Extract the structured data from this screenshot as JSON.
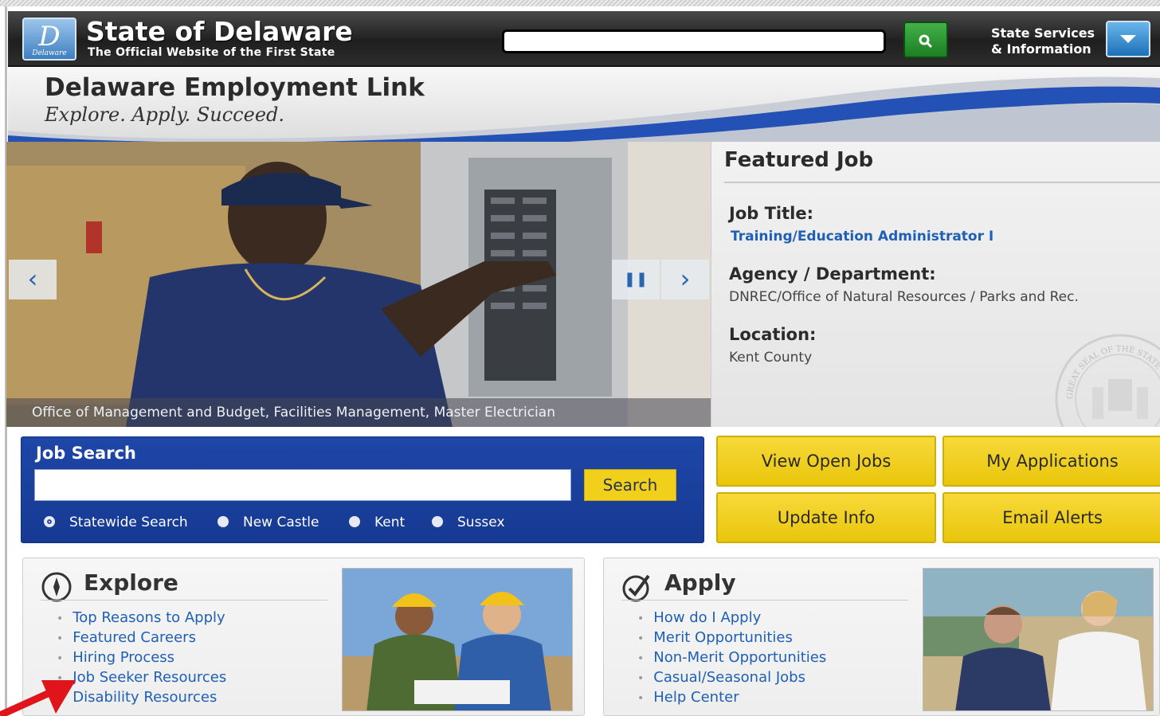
{
  "header": {
    "logo_letter": "D",
    "logo_text": "Delaware",
    "site_title": "State of Delaware",
    "site_subtitle": "The Official Website of the First State",
    "search_placeholder": "",
    "search_icon": "magnifier-icon",
    "state_services_line1": "State Services",
    "state_services_line2": "& Information",
    "dropdown_icon": "chevron-down-icon"
  },
  "banner": {
    "title": "Delaware Employment Link",
    "tagline": "Explore. Apply. Succeed."
  },
  "hero": {
    "caption": "Office of Management and Budget, Facilities Management, Master Electrician",
    "prev_symbol": "‹",
    "pause_symbol": "❚❚",
    "next_symbol": "›"
  },
  "featured": {
    "heading": "Featured Job",
    "job_title_label": "Job Title:",
    "job_title": "Training/Education Administrator I",
    "agency_label": "Agency / Department:",
    "agency": "DNREC/Office of Natural Resources / Parks and Rec.",
    "location_label": "Location:",
    "location": "Kent County",
    "seal_text": "GREAT SEAL OF THE STATE OF"
  },
  "job_search": {
    "title": "Job Search",
    "input_value": "",
    "button": "Search",
    "options": [
      "Statewide Search",
      "New Castle",
      "Kent",
      "Sussex"
    ],
    "selected": "Statewide Search"
  },
  "actions": {
    "view_open_jobs": "View Open Jobs",
    "my_applications": "My Applications",
    "update_info": "Update Info",
    "email_alerts": "Email Alerts"
  },
  "explore": {
    "title": "Explore",
    "links": [
      "Top Reasons to Apply",
      "Featured Careers",
      "Hiring Process",
      "Job Seeker Resources",
      "Disability Resources"
    ]
  },
  "apply": {
    "title": "Apply",
    "links": [
      "How do I Apply",
      "Merit Opportunities",
      "Non-Merit Opportunities",
      "Casual/Seasonal Jobs",
      "Help Center"
    ]
  },
  "colors": {
    "accent_blue": "#1e46a8",
    "link_blue": "#1f5fb4",
    "button_yellow": "#f1d01b",
    "search_green": "#2a9a32",
    "annotation_red": "#e0141b"
  }
}
